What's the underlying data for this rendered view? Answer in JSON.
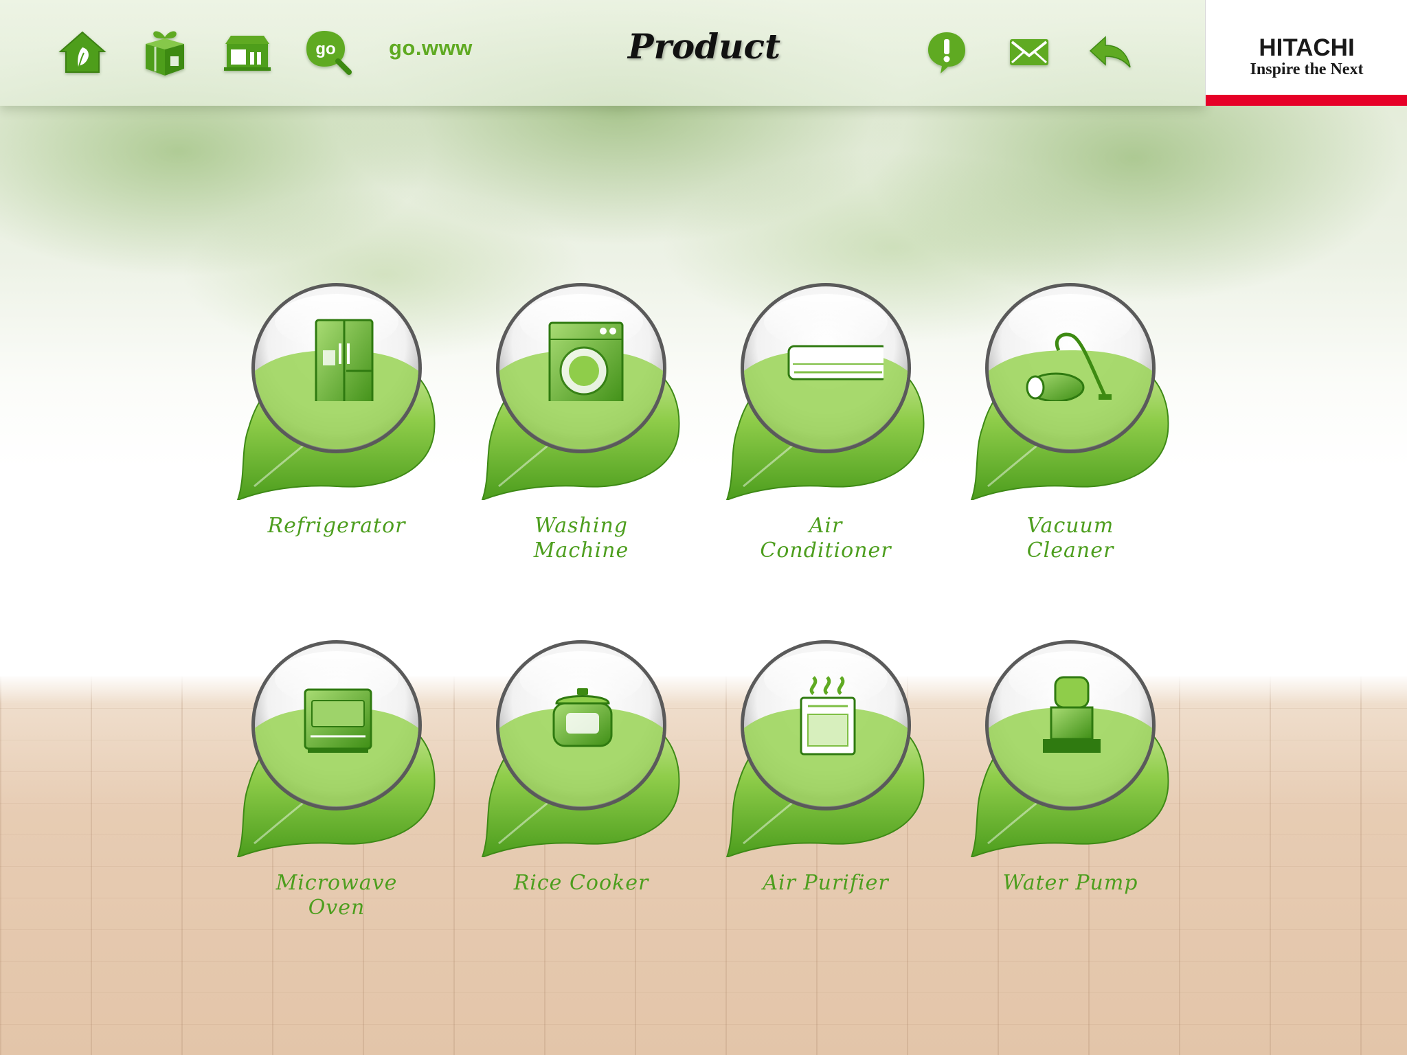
{
  "header": {
    "title": "Product",
    "go_web_label": "go.www",
    "go_badge": "go",
    "nav_icons": [
      "home-icon",
      "gift-box-icon",
      "store-icon",
      "go-search-icon",
      "alert-icon",
      "mail-icon",
      "back-arrow-icon"
    ]
  },
  "logo": {
    "name": "HITACHI",
    "tagline": "Inspire the Next",
    "stripe_color": "#e60027"
  },
  "theme": {
    "accent": "#5faa22",
    "label_color": "#4d9e1e"
  },
  "products": [
    {
      "line1": "Refrigerator",
      "line2": "",
      "icon": "refrigerator-icon"
    },
    {
      "line1": "Washing",
      "line2": "Machine",
      "icon": "washing-machine-icon"
    },
    {
      "line1": "Air",
      "line2": "Conditioner",
      "icon": "air-conditioner-icon"
    },
    {
      "line1": "Vacuum",
      "line2": "Cleaner",
      "icon": "vacuum-cleaner-icon"
    },
    {
      "line1": "Microwave",
      "line2": "Oven",
      "icon": "microwave-oven-icon"
    },
    {
      "line1": "Rice Cooker",
      "line2": "",
      "icon": "rice-cooker-icon"
    },
    {
      "line1": "Air Purifier",
      "line2": "",
      "icon": "air-purifier-icon"
    },
    {
      "line1": "Water Pump",
      "line2": "",
      "icon": "water-pump-icon"
    }
  ]
}
